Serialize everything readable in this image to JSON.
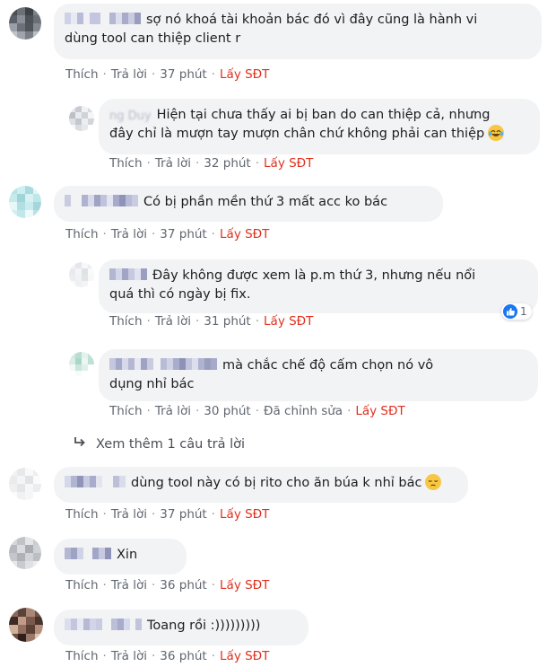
{
  "comments": [
    {
      "text_line1": "sợ nó khoá tài khoản bác đó vì đây cũng là hành vi",
      "text_line2": "dùng tool can thiệp client r",
      "like_label": "Thích",
      "reply_label": "Trả lời",
      "time": "37 phút",
      "phone_label": "Lấy SĐT"
    },
    {
      "name_partial": "ng Duy",
      "text_line1": "Hiện tại chưa thấy ai bị ban do can thiệp cả, nhưng",
      "text_line2": "đây chỉ là mượn tay mượn chân chứ không phải can thiệp",
      "emoji": "laughing-tears-emoji",
      "like_label": "Thích",
      "reply_label": "Trả lời",
      "time": "32 phút",
      "phone_label": "Lấy SĐT"
    },
    {
      "text_line1": "Có bị phần mền thứ 3 mất acc ko bác",
      "like_label": "Thích",
      "reply_label": "Trả lời",
      "time": "37 phút",
      "phone_label": "Lấy SĐT"
    },
    {
      "text_line1": "Đây không được xem là p.m thứ 3, nhưng nếu nổi",
      "text_line2": "quá thì có ngày bị fix.",
      "reaction_count": "1",
      "like_label": "Thích",
      "reply_label": "Trả lời",
      "time": "31 phút",
      "phone_label": "Lấy SĐT"
    },
    {
      "text_line1": "mà chắc chế độ cấm chọn nó vô",
      "text_line2": "dụng nhỉ bác",
      "like_label": "Thích",
      "reply_label": "Trả lời",
      "time": "30 phút",
      "edited_label": "Đã chỉnh sửa",
      "phone_label": "Lấy SĐT"
    },
    {
      "text_line1": "dùng tool này có bị rito cho ăn búa k nhỉ bác",
      "emoji": "pensive-emoji",
      "like_label": "Thích",
      "reply_label": "Trả lời",
      "time": "37 phút",
      "phone_label": "Lấy SĐT"
    },
    {
      "text_line1": "Xin",
      "like_label": "Thích",
      "reply_label": "Trả lời",
      "time": "36 phút",
      "phone_label": "Lấy SĐT"
    },
    {
      "text_line1": "Toang rồi :)))))))))",
      "like_label": "Thích",
      "reply_label": "Trả lời",
      "time": "36 phút",
      "phone_label": "Lấy SĐT"
    }
  ],
  "see_more": {
    "label": "Xem thêm 1 câu trả lời",
    "icon": "reply-arrow-icon"
  },
  "colors": {
    "bubble": "#f2f3f5",
    "link_red": "#e0301e",
    "meta_gray": "#606770",
    "like_blue": "#1877f2"
  }
}
